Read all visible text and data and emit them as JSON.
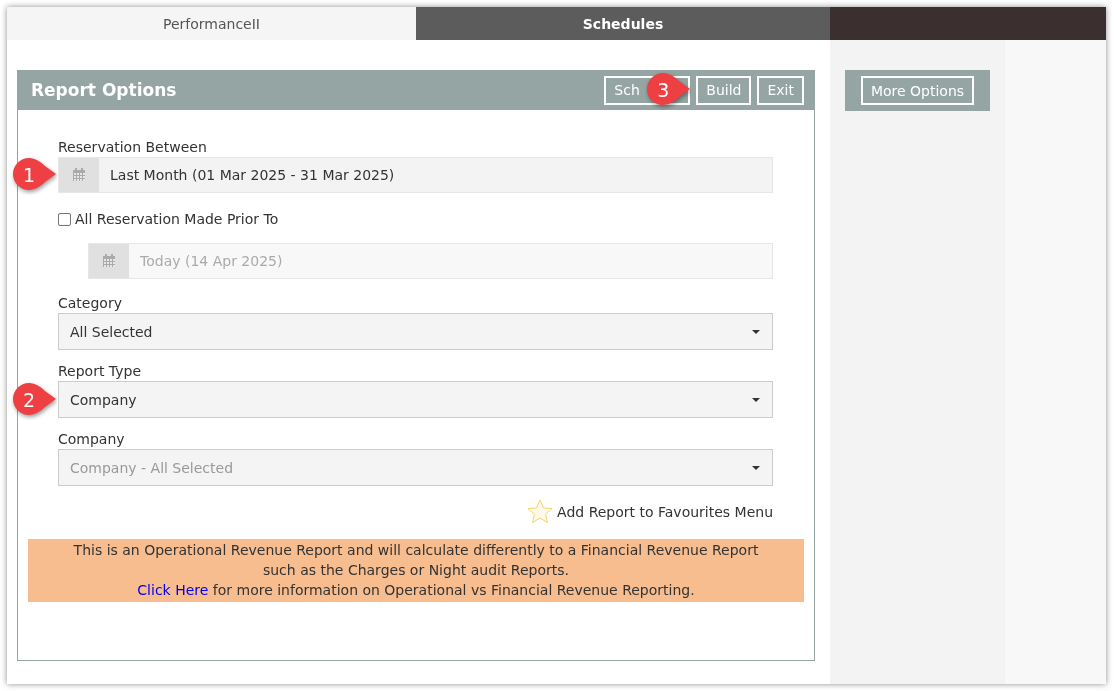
{
  "tabs": [
    {
      "label": "PerformanceII",
      "selected": true
    },
    {
      "label": "Schedules",
      "selected": false
    }
  ],
  "panel": {
    "title": "Report Options",
    "buttons": [
      {
        "label": "Sch"
      },
      {
        "label": "Build",
        "callout": "3"
      },
      {
        "label": "Exit"
      }
    ]
  },
  "side_buttons": [
    "More Options"
  ],
  "fields": [
    {
      "kind": "date",
      "label": "Reservation Between",
      "value": "Last Month (01 Mar 2025 - 31 Mar 2025)",
      "disabled": false,
      "callout": "1"
    },
    {
      "kind": "checkbox",
      "label": "All Reservation Made Prior To",
      "checked": false
    },
    {
      "kind": "date",
      "value": "Today (14 Apr 2025)",
      "disabled": true
    },
    {
      "kind": "select",
      "label": "Category",
      "value": "All Selected",
      "disabled": false
    },
    {
      "kind": "select",
      "label": "Report Type",
      "value": "Company",
      "disabled": false,
      "callout": "2"
    },
    {
      "kind": "select",
      "label": "Company",
      "value": "Company - All Selected",
      "disabled": true
    }
  ],
  "favourite": {
    "label": "Add Report to Favourites Menu"
  },
  "notice": {
    "lines": [
      "This is an Operational Revenue Report and will calculate differently to a Financial Revenue Report",
      "such as the Charges or Night audit Reports."
    ],
    "link": "Click Here",
    "link_tail": " for more information on Operational vs Financial Revenue Reporting."
  }
}
